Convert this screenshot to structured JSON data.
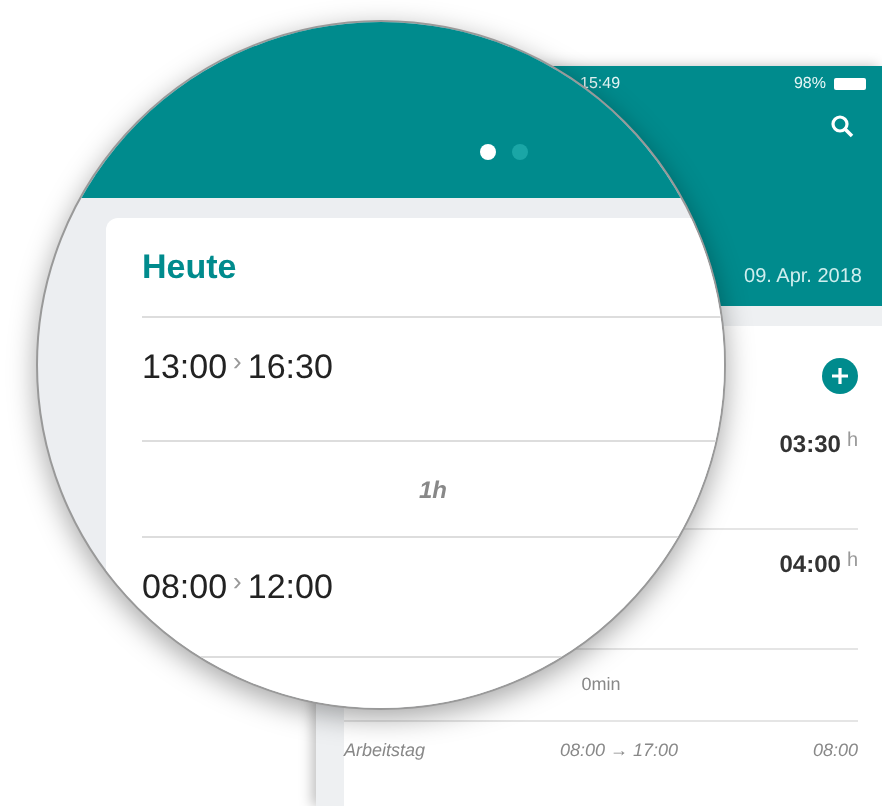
{
  "phone": {
    "status_bar": {
      "time": "15:49",
      "battery": "98%"
    },
    "header": {
      "date": "09. Apr. 2018"
    },
    "entries": [
      {
        "kind": "duration",
        "value": "03:30",
        "unit": "h"
      },
      {
        "kind": "duration",
        "value": "04:00",
        "unit": "h"
      },
      {
        "kind": "pause",
        "value": "0min"
      }
    ],
    "summary": {
      "label": "Arbeitstag",
      "range": "08:00 → 17:00",
      "total": "08:00"
    }
  },
  "magnifier": {
    "pages": [
      {
        "selected": true
      },
      {
        "selected": false
      }
    ],
    "title": "Heute",
    "entries": [
      {
        "kind": "range",
        "start": "13:00",
        "separator": "›",
        "end": "16:30"
      },
      {
        "kind": "pause",
        "value": "1h"
      },
      {
        "kind": "range",
        "start": "08:00",
        "separator": "›",
        "end": "12:00"
      }
    ]
  }
}
